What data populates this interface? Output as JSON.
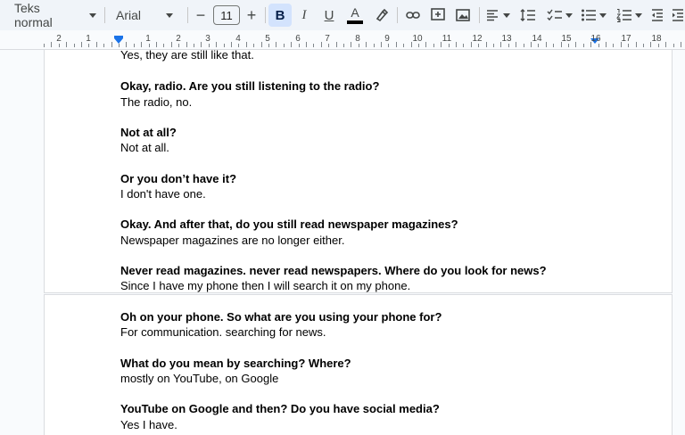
{
  "toolbar": {
    "style_label": "Teks normal",
    "font_label": "Arial",
    "font_size": "11",
    "minus_label": "−",
    "plus_label": "+",
    "bold_label": "B",
    "italic_label": "I",
    "underline_label": "U",
    "text_color_label": "A"
  },
  "ruler": {
    "numbers": [
      "2",
      "1",
      "1",
      "2",
      "3",
      "4",
      "5",
      "6",
      "7",
      "8",
      "9",
      "10",
      "11",
      "12",
      "13",
      "14",
      "15",
      "16",
      "17",
      "18"
    ]
  },
  "document": {
    "page1": [
      {
        "text": "Yes, they are still like that.",
        "bold": false
      },
      {
        "text": "Okay, radio. Are you still listening to the radio?",
        "bold": true
      },
      {
        "text": "The radio, no.",
        "bold": false
      },
      {
        "text": "Not at all?",
        "bold": true
      },
      {
        "text": "Not at all.",
        "bold": false
      },
      {
        "text": "Or you don’t have it?",
        "bold": true
      },
      {
        "text": "I don't have one.",
        "bold": false
      },
      {
        "text": "Okay. And after that, do you still read newspaper magazines?",
        "bold": true
      },
      {
        "text": "Newspaper magazines are no longer either.",
        "bold": false
      },
      {
        "text": "Never read magazines. never read newspapers. Where do you look for news?",
        "bold": true
      },
      {
        "text": "Since I have my phone then I will search it on my phone.",
        "bold": false
      }
    ],
    "page2": [
      {
        "text": "Oh on your phone. So what are you using your phone for?",
        "bold": true
      },
      {
        "text": "For communication. searching for news.",
        "bold": false
      },
      {
        "text": "What do you mean by searching? Where?",
        "bold": true
      },
      {
        "text": "mostly on YouTube, on Google",
        "bold": false
      },
      {
        "text": "YouTube on Google and then? Do you have social media?",
        "bold": true
      },
      {
        "text": "Yes I have.",
        "bold": false
      }
    ]
  },
  "colors": {
    "toolbar_bg": "#f0f4f9",
    "active_button_bg": "#d3e3fd",
    "accent": "#1a73e8",
    "icon": "#444746"
  }
}
